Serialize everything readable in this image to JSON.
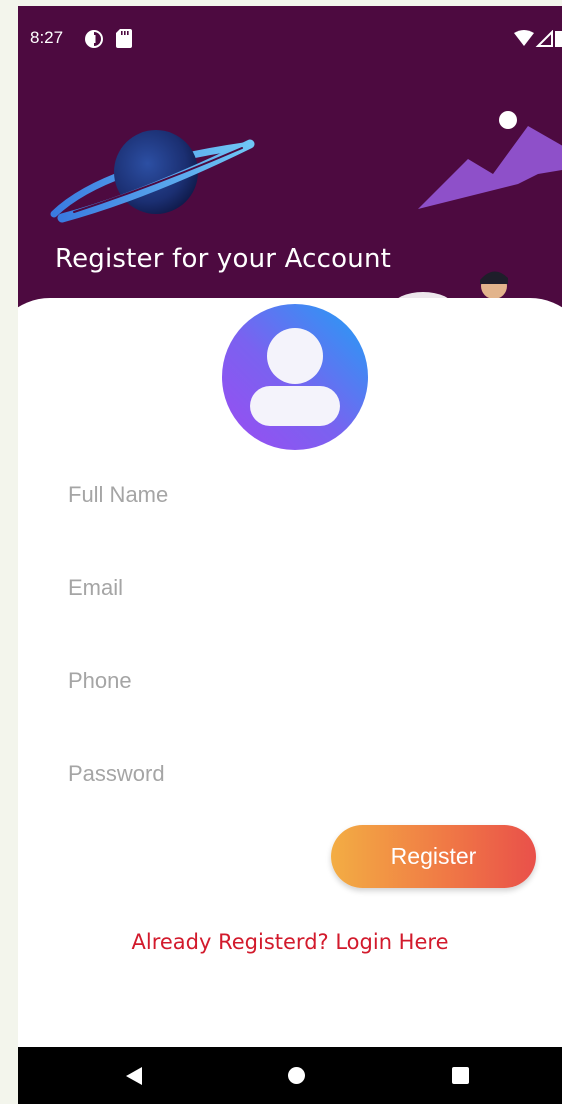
{
  "status_bar": {
    "time": "8:27",
    "icons": [
      "data-saver-icon",
      "sd-card-icon",
      "wifi-icon",
      "signal-icon",
      "battery-icon"
    ]
  },
  "header": {
    "title": "Register for your Account",
    "background_color": "#4d0a40",
    "illustrations": [
      "planet-icon",
      "mountain-icon",
      "person-illustration"
    ]
  },
  "avatar": {
    "icon": "user-avatar-icon",
    "gradient": [
      "#9b4cf2",
      "#1fa0f5"
    ]
  },
  "form": {
    "full_name": {
      "placeholder": "Full Name",
      "value": ""
    },
    "email": {
      "placeholder": "Email",
      "value": ""
    },
    "phone": {
      "placeholder": "Phone",
      "value": ""
    },
    "password": {
      "placeholder": "Password",
      "value": ""
    }
  },
  "register_button": {
    "label": "Register",
    "gradient": [
      "#f3ad44",
      "#e9504a"
    ]
  },
  "login_link": {
    "label": "Already Registerd? Login Here",
    "color": "#d21a2c"
  },
  "nav_bar": {
    "icons": [
      "back-icon",
      "home-icon",
      "recents-icon"
    ]
  }
}
